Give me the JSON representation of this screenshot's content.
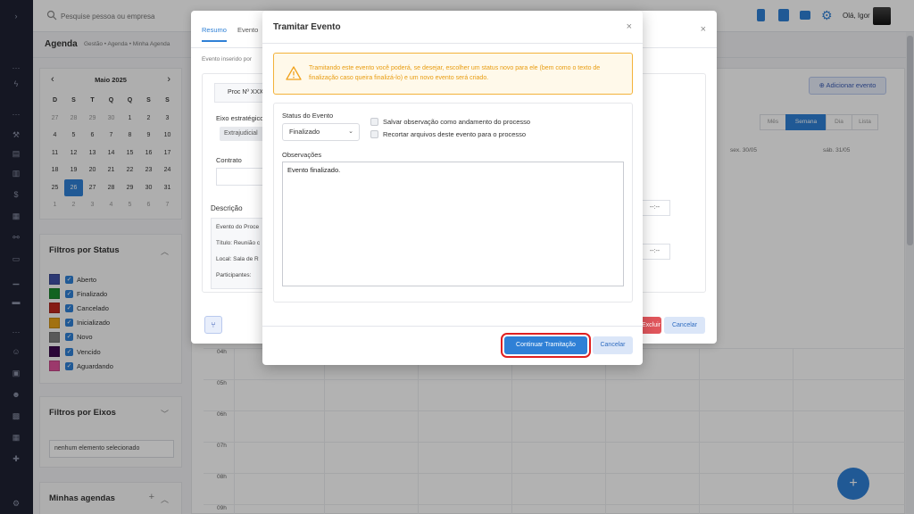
{
  "topbar": {
    "search_placeholder": "Pesquise pessoa ou empresa",
    "user_name": "Olá, Igor"
  },
  "breadcrumb": {
    "title": "Agenda",
    "trail": "Gestão  •  Agenda  •  Minha Agenda"
  },
  "mini_calendar": {
    "month": "Maio 2025",
    "prev": "‹",
    "next": "›",
    "weekdays": [
      "D",
      "S",
      "T",
      "Q",
      "Q",
      "S",
      "S"
    ],
    "days": [
      {
        "d": "27",
        "muted": true
      },
      {
        "d": "28",
        "muted": true
      },
      {
        "d": "29",
        "muted": true
      },
      {
        "d": "30",
        "muted": true
      },
      {
        "d": "1"
      },
      {
        "d": "2"
      },
      {
        "d": "3"
      },
      {
        "d": "4"
      },
      {
        "d": "5"
      },
      {
        "d": "6"
      },
      {
        "d": "7"
      },
      {
        "d": "8"
      },
      {
        "d": "9"
      },
      {
        "d": "10"
      },
      {
        "d": "11"
      },
      {
        "d": "12"
      },
      {
        "d": "13"
      },
      {
        "d": "14"
      },
      {
        "d": "15"
      },
      {
        "d": "16"
      },
      {
        "d": "17"
      },
      {
        "d": "18"
      },
      {
        "d": "19"
      },
      {
        "d": "20"
      },
      {
        "d": "21"
      },
      {
        "d": "22"
      },
      {
        "d": "23"
      },
      {
        "d": "24"
      },
      {
        "d": "25"
      },
      {
        "d": "26",
        "selected": true
      },
      {
        "d": "27"
      },
      {
        "d": "28"
      },
      {
        "d": "29"
      },
      {
        "d": "30"
      },
      {
        "d": "31"
      },
      {
        "d": "1",
        "muted": true
      },
      {
        "d": "2",
        "muted": true
      },
      {
        "d": "3",
        "muted": true
      },
      {
        "d": "4",
        "muted": true
      },
      {
        "d": "5",
        "muted": true
      },
      {
        "d": "6",
        "muted": true
      },
      {
        "d": "7",
        "muted": true
      }
    ]
  },
  "status_filter": {
    "title": "Filtros por Status",
    "items": [
      {
        "label": "Aberto",
        "color": "#3f51a5"
      },
      {
        "label": "Finalizado",
        "color": "#1a8f2e"
      },
      {
        "label": "Cancelado",
        "color": "#c0291f"
      },
      {
        "label": "Inicializado",
        "color": "#e8a317"
      },
      {
        "label": "Novo",
        "color": "#808080"
      },
      {
        "label": "Vencido",
        "color": "#3d0a4f"
      },
      {
        "label": "Aguardando",
        "color": "#e0529b"
      }
    ]
  },
  "eixos_filter": {
    "title": "Filtros por Eixos",
    "value": "nenhum elemento selecionado"
  },
  "agendas": {
    "title": "Minhas agendas"
  },
  "calendar": {
    "add_event": "Adicionar evento",
    "views": [
      "Mês",
      "Semana",
      "Dia",
      "Lista"
    ],
    "active_view": "Semana",
    "day_headers": [
      "sex. 30/05",
      "sáb. 31/05"
    ],
    "hours": [
      "04h",
      "05h",
      "06h",
      "07h",
      "08h",
      "09h"
    ]
  },
  "event_modal": {
    "tabs": [
      "Resumo",
      "Evento"
    ],
    "subtitle": "Evento inserido por",
    "proc": "Proc Nº XXXXXX",
    "eixo_label": "Eixo estratégico",
    "eixo_value": "Extrajudicial",
    "contrato_label": "Contrato",
    "descricao_label": "Descrição",
    "descricao_lines": [
      "Evento do Proce",
      "Título: Reunião c",
      "Local: Sala de R",
      "Participantes:"
    ],
    "time_placeholder": "--:--",
    "excluir_label": "Excluir",
    "cancel_label": "Cancelar",
    "close": "×"
  },
  "tramitar_modal": {
    "title": "Tramitar Evento",
    "close": "×",
    "warning": "Tramitando este evento você poderá, se desejar, escolher um status novo para ele (bem como o texto de finalização caso queira finalizá-lo) e um novo evento será criado.",
    "status_label": "Status do Evento",
    "status_value": "Finalizado",
    "check1": "Salvar observação como andamento do processo",
    "check2": "Recortar arquivos deste evento para o processo",
    "obs_label": "Observações",
    "obs_value": "Evento finalizado.",
    "continue_label": "Continuar Tramitação",
    "cancel_label": "Cancelar",
    "warning_color": "#f3b23a",
    "primary_color": "#2f80d6"
  }
}
